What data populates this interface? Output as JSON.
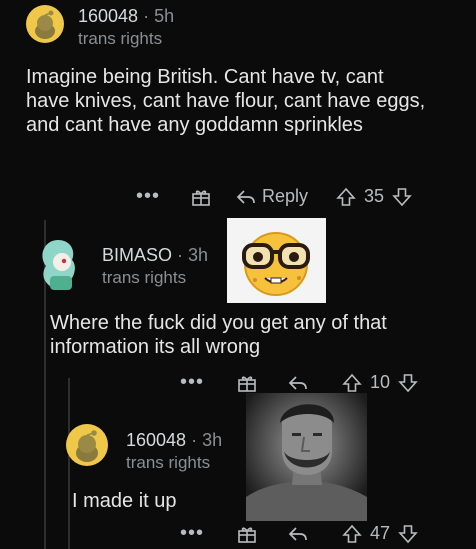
{
  "comments": [
    {
      "username": "160048",
      "age": "5h",
      "subtitle": "trans rights",
      "body": "Imagine being British. Cant have tv, cant have knives, cant have flour, cant have eggs, and cant have any goddamn sprinkles",
      "reply_label": "Reply",
      "score": "35"
    },
    {
      "username": "BIMASO",
      "age": "3h",
      "subtitle": "trans rights",
      "body": "Where the fuck did you get any of that information its all wrong",
      "score": "10",
      "sticker": "nerd-face-emoji"
    },
    {
      "username": "160048",
      "age": "3h",
      "subtitle": "trans rights",
      "body": "I made it up",
      "score": "47",
      "sticker": "gigachad-photo"
    }
  ],
  "separator": "·",
  "more_label": "•••",
  "colors": {
    "background": "#0b0b0b",
    "text": "#d7dadc",
    "muted": "#8b8f93",
    "avatar_yellow": "#efc84a"
  }
}
